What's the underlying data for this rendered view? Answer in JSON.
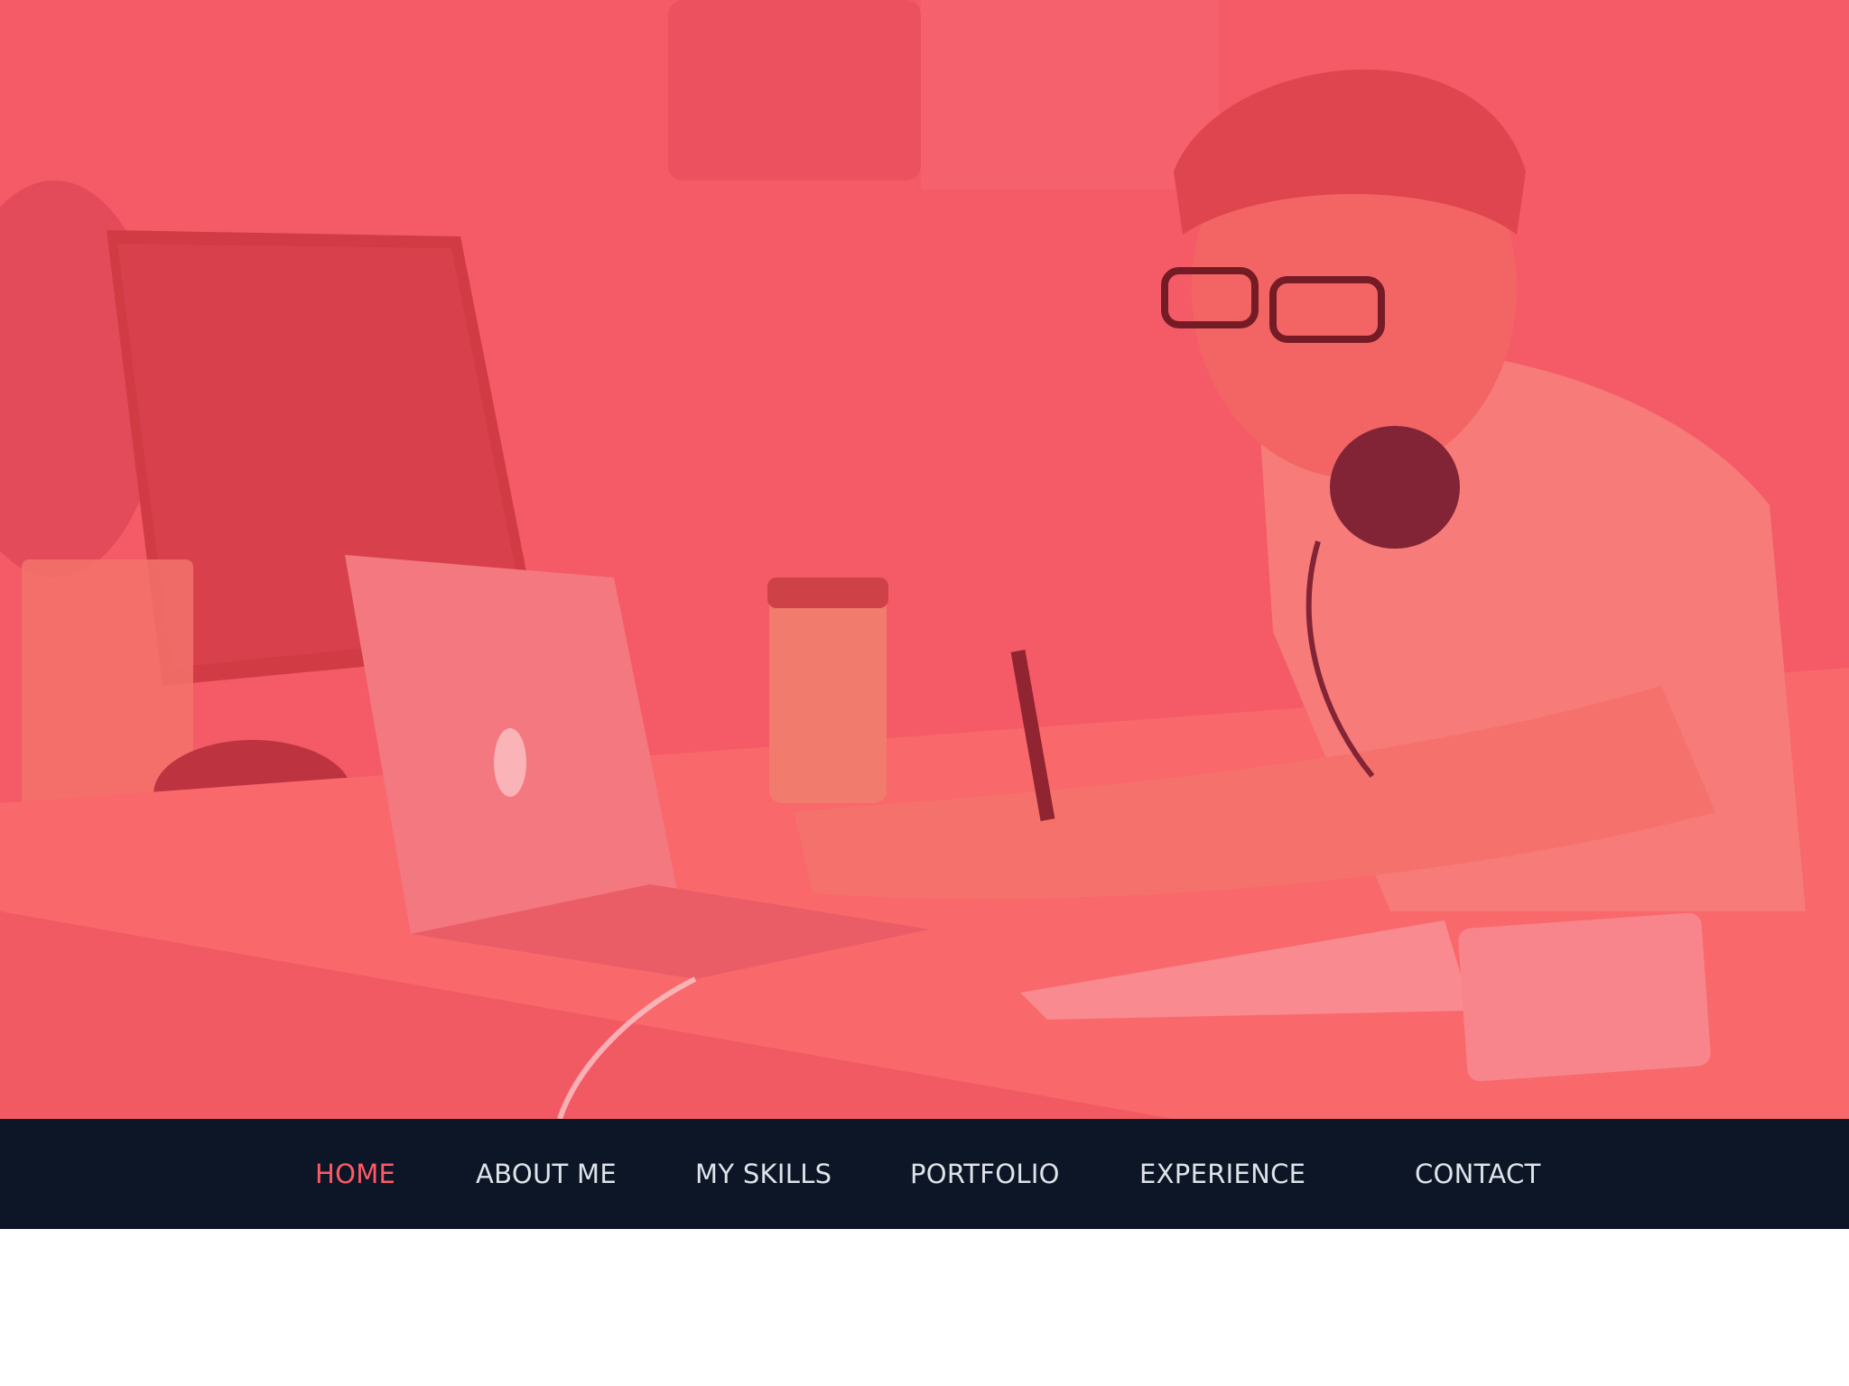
{
  "hero": {
    "image": "photo-man-at-laptop-with-headphones",
    "overlay_color": "#f2535f"
  },
  "nav": {
    "items": [
      {
        "label": "HOME",
        "active": true
      },
      {
        "label": "ABOUT ME",
        "active": false
      },
      {
        "label": "MY SKILLS",
        "active": false
      },
      {
        "label": "PORTFOLIO",
        "active": false
      },
      {
        "label": "EXPERIENCE",
        "active": false
      },
      {
        "label": "CONTACT",
        "active": false
      }
    ],
    "background": "#0c1626",
    "text_color": "#dfe3ea",
    "active_color": "#ff5a66"
  }
}
